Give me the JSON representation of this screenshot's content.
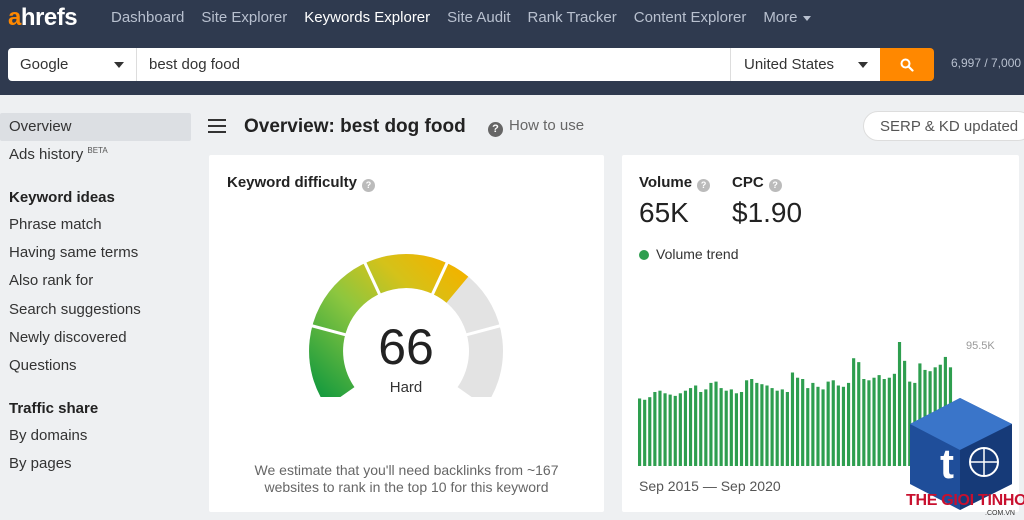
{
  "brand": {
    "logo_a": "a",
    "logo_rest": "hrefs",
    "accent": "#ff8800",
    "nav_bg": "#2f3a4f"
  },
  "nav": {
    "items": [
      {
        "label": "Dashboard"
      },
      {
        "label": "Site Explorer"
      },
      {
        "label": "Keywords Explorer",
        "active": true
      },
      {
        "label": "Site Audit"
      },
      {
        "label": "Rank Tracker"
      },
      {
        "label": "Content Explorer"
      },
      {
        "label": "More"
      }
    ]
  },
  "search": {
    "engine": "Google",
    "query": "best dog food",
    "country": "United States",
    "button_icon": "search-icon",
    "credits": "6,997 / 7,000"
  },
  "sidebar": {
    "overview": "Overview",
    "ads_history": "Ads history",
    "ads_badge": "BETA",
    "keyword_ideas_head": "Keyword ideas",
    "keyword_ideas": [
      "Phrase match",
      "Having same terms",
      "Also rank for",
      "Search suggestions",
      "Newly discovered",
      "Questions"
    ],
    "traffic_head": "Traffic share",
    "traffic": [
      "By domains",
      "By pages"
    ]
  },
  "header": {
    "title": "Overview: best dog food",
    "how_to": "How to use",
    "updated": "SERP & KD updated"
  },
  "difficulty": {
    "title": "Keyword difficulty",
    "value": "66",
    "score": 66,
    "label": "Hard",
    "note_line1": "We estimate that you'll need backlinks from ~167",
    "note_line2": "websites to rank in the top 10 for this keyword"
  },
  "metrics": {
    "volume_label": "Volume",
    "volume_value": "65K",
    "cpc_label": "CPC",
    "cpc_value": "$1.90",
    "trend_label": "Volume trend",
    "trend_color": "#2e9e4f",
    "peak_label": "95.5K",
    "date_range": "Sep 2015 — Sep 2020"
  },
  "chart_data": {
    "type": "bar",
    "title": "Volume trend",
    "ylim": [
      0,
      95500
    ],
    "values": [
      52000,
      51000,
      53000,
      57000,
      58000,
      56000,
      55000,
      54000,
      56000,
      58000,
      60000,
      62000,
      57000,
      59000,
      64000,
      65000,
      60000,
      58000,
      59000,
      56000,
      57000,
      66000,
      67000,
      64000,
      63000,
      62000,
      60000,
      58000,
      59000,
      57000,
      72000,
      68000,
      67000,
      60000,
      64000,
      61000,
      59000,
      65000,
      66000,
      62000,
      61000,
      64000,
      83000,
      80000,
      67000,
      66000,
      68000,
      70000,
      67000,
      68000,
      71000,
      95500,
      81000,
      65000,
      64000,
      79000,
      74000,
      73000,
      76000,
      78000,
      84000,
      76000
    ]
  },
  "watermark": {
    "text": "THE GIOI TINHOC",
    "sub": ".COM.VN"
  }
}
